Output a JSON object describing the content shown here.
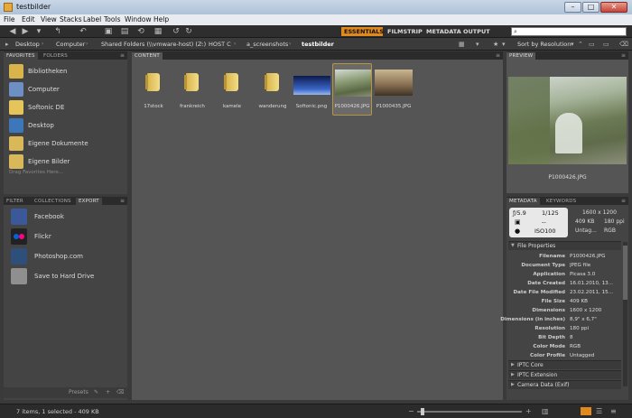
{
  "window": {
    "title": "testbilder"
  },
  "menu": [
    "File",
    "Edit",
    "View",
    "Stacks",
    "Label",
    "Tools",
    "Window",
    "Help"
  ],
  "workspaces": {
    "essentials": "ESSENTIALS",
    "filmstrip": "FILMSTRIP",
    "metadata": "METADATA",
    "output": "OUTPUT",
    "active": "ESSENTIALS"
  },
  "search": {
    "placeholder": ""
  },
  "breadcrumbs": [
    "Desktop",
    "Computer",
    "Shared Folders (\\\\vmware-host) (Z:)",
    "HOST C",
    "a_screenshots",
    "testbilder"
  ],
  "sort": {
    "label": "Sort by Resolution"
  },
  "favorites": {
    "tabs": [
      "FAVORITES",
      "FOLDERS"
    ],
    "items": [
      {
        "label": "Bibliotheken",
        "icon": "libraries-icon"
      },
      {
        "label": "Computer",
        "icon": "computer-icon"
      },
      {
        "label": "Softonic DE",
        "icon": "folder-icon"
      },
      {
        "label": "Desktop",
        "icon": "desktop-icon"
      },
      {
        "label": "Eigene Dokumente",
        "icon": "documents-icon"
      },
      {
        "label": "Eigene Bilder",
        "icon": "pictures-icon"
      }
    ],
    "hint": "Drag Favorites Here..."
  },
  "export": {
    "tabs": [
      "FILTER",
      "COLLECTIONS",
      "EXPORT"
    ],
    "items": [
      {
        "label": "Facebook",
        "icon": "facebook-icon"
      },
      {
        "label": "Flickr",
        "icon": "flickr-icon"
      },
      {
        "label": "Photoshop.com",
        "icon": "photoshop-icon"
      },
      {
        "label": "Save to Hard Drive",
        "icon": "hard-drive-icon"
      }
    ],
    "presets_label": "Presets"
  },
  "content": {
    "tab": "CONTENT",
    "items": [
      {
        "label": "17stock",
        "type": "folder"
      },
      {
        "label": "frankreich",
        "type": "folder"
      },
      {
        "label": "kamele",
        "type": "folder"
      },
      {
        "label": "wanderung",
        "type": "folder"
      },
      {
        "label": "Softonic.png",
        "type": "image"
      },
      {
        "label": "P1000426.JPG",
        "type": "image",
        "selected": true
      },
      {
        "label": "P1000435.JPG",
        "type": "image"
      }
    ]
  },
  "preview": {
    "tab": "PREVIEW",
    "filename": "P1000426.JPG"
  },
  "metadata": {
    "tabs": [
      "METADATA",
      "KEYWORDS"
    ],
    "camera": {
      "aperture": "ƒ/5.9",
      "shutter": "1/125",
      "metering": "--",
      "iso": "ISO100"
    },
    "image": {
      "dimensions": "1600 x 1200",
      "size": "409 KB",
      "ppi": "180 ppi",
      "tag": "Untag...",
      "mode": "RGB"
    },
    "section_file_properties": "File Properties",
    "properties": [
      {
        "key": "Filename",
        "value": "P1000426.JPG"
      },
      {
        "key": "Document Type",
        "value": "JPEG file"
      },
      {
        "key": "Application",
        "value": "Picasa 3.0"
      },
      {
        "key": "Date Created",
        "value": "16.01.2010, 13..."
      },
      {
        "key": "Date File Modified",
        "value": "23.02.2011, 15..."
      },
      {
        "key": "File Size",
        "value": "409 KB"
      },
      {
        "key": "Dimensions",
        "value": "1600 x 1200"
      },
      {
        "key": "Dimensions (in inches)",
        "value": "8,9\" x 6,7\""
      },
      {
        "key": "Resolution",
        "value": "180 ppi"
      },
      {
        "key": "Bit Depth",
        "value": "8"
      },
      {
        "key": "Color Mode",
        "value": "RGB"
      },
      {
        "key": "Color Profile",
        "value": "Untagged"
      }
    ],
    "sections": [
      "IPTC Core",
      "IPTC Extension",
      "Camera Data (Exif)"
    ]
  },
  "status": {
    "text": "7 items, 1 selected - 409 KB"
  },
  "colors": {
    "accent": "#e08a1e",
    "panel": "#444444",
    "content_bg": "#555555"
  }
}
